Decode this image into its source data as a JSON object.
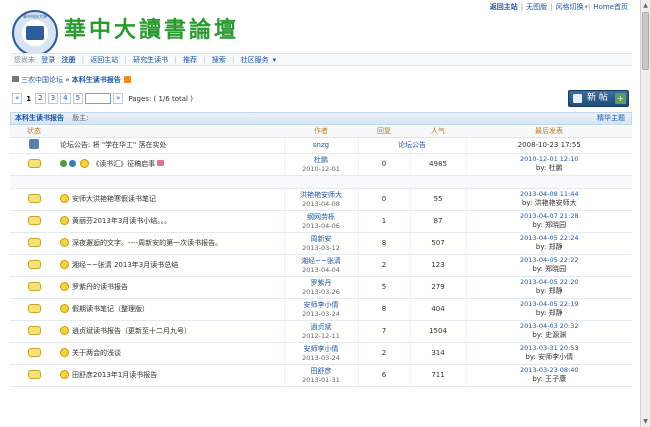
{
  "top_links": {
    "back": "返回主站",
    "no_image": "无图版",
    "style_switch": "风格切换",
    "home": "Home首页"
  },
  "site": {
    "title": "華中大讀書論壇",
    "logo_text": "華中科技大學"
  },
  "nav": {
    "items": [
      "您尚未",
      "登录",
      "注册",
      "返回主站",
      "研究生读书",
      "推荐",
      "搜索",
      "社区服务"
    ]
  },
  "breadcrumb": {
    "root": "三农中国论坛",
    "sep": "»",
    "forum": "本科生读书报告"
  },
  "pager": {
    "prev": "«",
    "current": "1",
    "pages": [
      "2",
      "3",
      "4",
      "5"
    ],
    "next": "»",
    "info": "Pages: ( 1/6 total )"
  },
  "new_post_label": "新 帖",
  "forum_header": {
    "name": "本科生读书报告",
    "moderator_label": "版主:",
    "digest_label": "精华主题"
  },
  "columns": {
    "status": "状态",
    "author": "作者",
    "replies": "回复",
    "views": "人气",
    "last": "最后发表"
  },
  "announcement": {
    "label": "论坛公告:",
    "title": "将 \"学在华工\" 落在实处",
    "author": "snzg",
    "replies_text": "论坛公告",
    "last": "2008-10-23 17:55"
  },
  "sticky": {
    "title": "《读书汇》征稿启事",
    "author": "杜鹏",
    "date": "2010-12-01",
    "replies": "0",
    "views": "4985",
    "last_date": "2010-12-01 12:10",
    "last_by": "by: 杜鹏"
  },
  "threads": [
    {
      "title": "安师大洪艳艳寒假读书笔记",
      "author": "洪艳艳安师大",
      "date": "2013-04-08",
      "replies": "0",
      "views": "55",
      "last_date": "2013-04-08 11:44",
      "last_by": "by: 洪艳艳安师大"
    },
    {
      "title": "黄丽芬2013年3月读书小结。。。",
      "author": "纲网劳栎",
      "date": "2013-04-06",
      "replies": "1",
      "views": "87",
      "last_date": "2013-04-07 21:28",
      "last_by": "by: 郑晓园"
    },
    {
      "title": "深夜邂逅的文字。----周新安的第一次读书报告。",
      "author": "周新安",
      "date": "2013-03-12",
      "replies": "8",
      "views": "507",
      "last_date": "2013-04-05 22:24",
      "last_by": "by: 郑静"
    },
    {
      "title": "湘经~~张清  2013年3月读书总结",
      "author": "湘经~~张清",
      "date": "2013-04-04",
      "replies": "2",
      "views": "123",
      "last_date": "2013-04-05 22:22",
      "last_by": "by: 郑晓园"
    },
    {
      "title": "罗紫丹的读书报告",
      "author": "罗紫丹",
      "date": "2013-03-26",
      "replies": "5",
      "views": "279",
      "last_date": "2013-04-05 22:20",
      "last_by": "by: 郑静"
    },
    {
      "title": "假期读书笔记（整理版）",
      "author": "安师李小倩",
      "date": "2013-03-24",
      "replies": "8",
      "views": "404",
      "last_date": "2013-04-05 22:19",
      "last_by": "by: 郑静"
    },
    {
      "title": "逍贞斌读书报告（更新至十二月九号）",
      "author": "逍贞斌",
      "date": "2012-12-11",
      "replies": "7",
      "views": "1504",
      "last_date": "2013-04-03 20:32",
      "last_by": "by: 史源渊"
    },
    {
      "title": "关于两会的浅谈",
      "author": "安师李小倩",
      "date": "2013-03-24",
      "replies": "2",
      "views": "314",
      "last_date": "2013-03-31 20:53",
      "last_by": "by: 安师李小倩"
    },
    {
      "title": "田舒彦2013年1月读书报告",
      "author": "田舒彦",
      "date": "2013-01-31",
      "replies": "6",
      "views": "711",
      "last_date": "2013-03-23 08:40",
      "last_by": "by: 王子康"
    }
  ]
}
